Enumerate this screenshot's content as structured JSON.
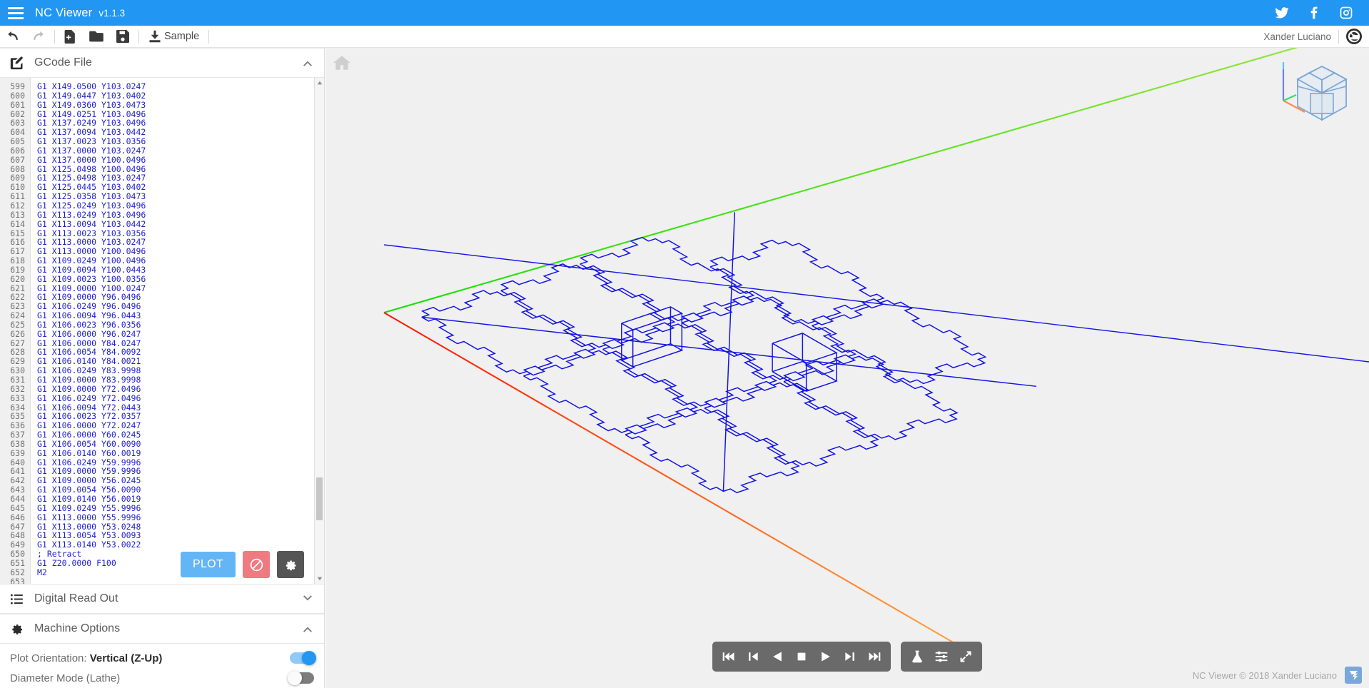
{
  "topbar": {
    "menu_icon": "hamburger-icon",
    "title": "NC Viewer",
    "version": "v1.1.3",
    "social": [
      {
        "name": "twitter-icon",
        "label": "Twitter"
      },
      {
        "name": "facebook-icon",
        "label": "Facebook"
      },
      {
        "name": "instagram-icon",
        "label": "Instagram"
      }
    ]
  },
  "toolbar": {
    "undo_label": "Undo",
    "redo_label": "Redo",
    "new_label": "New File",
    "open_label": "Open File",
    "save_label": "Save File",
    "sample_label": "Sample",
    "user_name": "Xander Luciano",
    "avatar_label": "Account"
  },
  "gcode_panel": {
    "title": "GCode File",
    "collapsed": false,
    "chevron": "chevron-up-icon",
    "icon": "edit-file-icon",
    "first_line_number": 599,
    "lines": [
      "G1 X149.0500 Y103.0247",
      "G1 X149.0447 Y103.0402",
      "G1 X149.0360 Y103.0473",
      "G1 X149.0251 Y103.0496",
      "G1 X137.0249 Y103.0496",
      "G1 X137.0094 Y103.0442",
      "G1 X137.0023 Y103.0356",
      "G1 X137.0000 Y103.0247",
      "G1 X137.0000 Y100.0496",
      "G1 X125.0498 Y100.0496",
      "G1 X125.0498 Y103.0247",
      "G1 X125.0445 Y103.0402",
      "G1 X125.0358 Y103.0473",
      "G1 X125.0249 Y103.0496",
      "G1 X113.0249 Y103.0496",
      "G1 X113.0094 Y103.0442",
      "G1 X113.0023 Y103.0356",
      "G1 X113.0000 Y103.0247",
      "G1 X113.0000 Y100.0496",
      "G1 X109.0249 Y100.0496",
      "G1 X109.0094 Y100.0443",
      "G1 X109.0023 Y100.0356",
      "G1 X109.0000 Y100.0247",
      "G1 X109.0000 Y96.0496",
      "G1 X106.0249 Y96.0496",
      "G1 X106.0094 Y96.0443",
      "G1 X106.0023 Y96.0356",
      "G1 X106.0000 Y96.0247",
      "G1 X106.0000 Y84.0247",
      "G1 X106.0054 Y84.0092",
      "G1 X106.0140 Y84.0021",
      "G1 X106.0249 Y83.9998",
      "G1 X109.0000 Y83.9998",
      "G1 X109.0000 Y72.0496",
      "G1 X106.0249 Y72.0496",
      "G1 X106.0094 Y72.0443",
      "G1 X106.0023 Y72.0357",
      "G1 X106.0000 Y72.0247",
      "G1 X106.0000 Y60.0245",
      "G1 X106.0054 Y60.0090",
      "G1 X106.0140 Y60.0019",
      "G1 X106.0249 Y59.9996",
      "G1 X109.0000 Y59.9996",
      "G1 X109.0000 Y56.0245",
      "G1 X109.0054 Y56.0090",
      "G1 X109.0140 Y56.0019",
      "G1 X109.0249 Y55.9996",
      "G1 X113.0000 Y55.9996",
      "G1 X113.0000 Y53.0248",
      "G1 X113.0054 Y53.0093",
      "G1 X113.0140 Y53.0022",
      "; Retract",
      "G1 Z20.0000 F100",
      "M2",
      ""
    ],
    "actions": {
      "plot_label": "PLOT",
      "clear_label": "Clear",
      "settings_label": "Settings"
    }
  },
  "dro_panel": {
    "title": "Digital Read Out",
    "collapsed": true,
    "chevron": "chevron-down-icon",
    "icon": "list-icon"
  },
  "machine_panel": {
    "title": "Machine Options",
    "collapsed": false,
    "chevron": "chevron-up-icon",
    "icon": "gear-icon",
    "options": [
      {
        "label_prefix": "Plot Orientation: ",
        "label_value": "Vertical (Z-Up)",
        "state": "on"
      },
      {
        "label_prefix": "Diameter Mode (Lathe)",
        "label_value": "",
        "state": "off"
      }
    ]
  },
  "viewport": {
    "background": "#f0f0f0",
    "home_icon": "home-icon",
    "viewcube_label": "View Cube",
    "axes": [
      {
        "name": "x-axis",
        "color": "#ff2a00"
      },
      {
        "name": "y-axis",
        "color": "#1fd40b"
      },
      {
        "name": "z-axis",
        "color": "#2fa8f5"
      }
    ],
    "toolpath_color": "#1414e6",
    "rapid_color": "#ff8c1a"
  },
  "playback": {
    "buttons": [
      {
        "name": "skip-to-start-button",
        "label": "Skip to start"
      },
      {
        "name": "step-back-button",
        "label": "Step back"
      },
      {
        "name": "play-reverse-button",
        "label": "Play reverse"
      },
      {
        "name": "stop-button",
        "label": "Stop"
      },
      {
        "name": "play-button",
        "label": "Play"
      },
      {
        "name": "step-forward-button",
        "label": "Step forward"
      },
      {
        "name": "skip-to-end-button",
        "label": "Skip to end"
      }
    ],
    "tools": [
      {
        "name": "flask-icon",
        "label": "Experimental"
      },
      {
        "name": "sliders-icon",
        "label": "View settings"
      },
      {
        "name": "expand-icon",
        "label": "Fullscreen"
      }
    ]
  },
  "footer": {
    "text": "NC Viewer © 2018 Xander Luciano",
    "logo": "nc-viewer-logo"
  }
}
